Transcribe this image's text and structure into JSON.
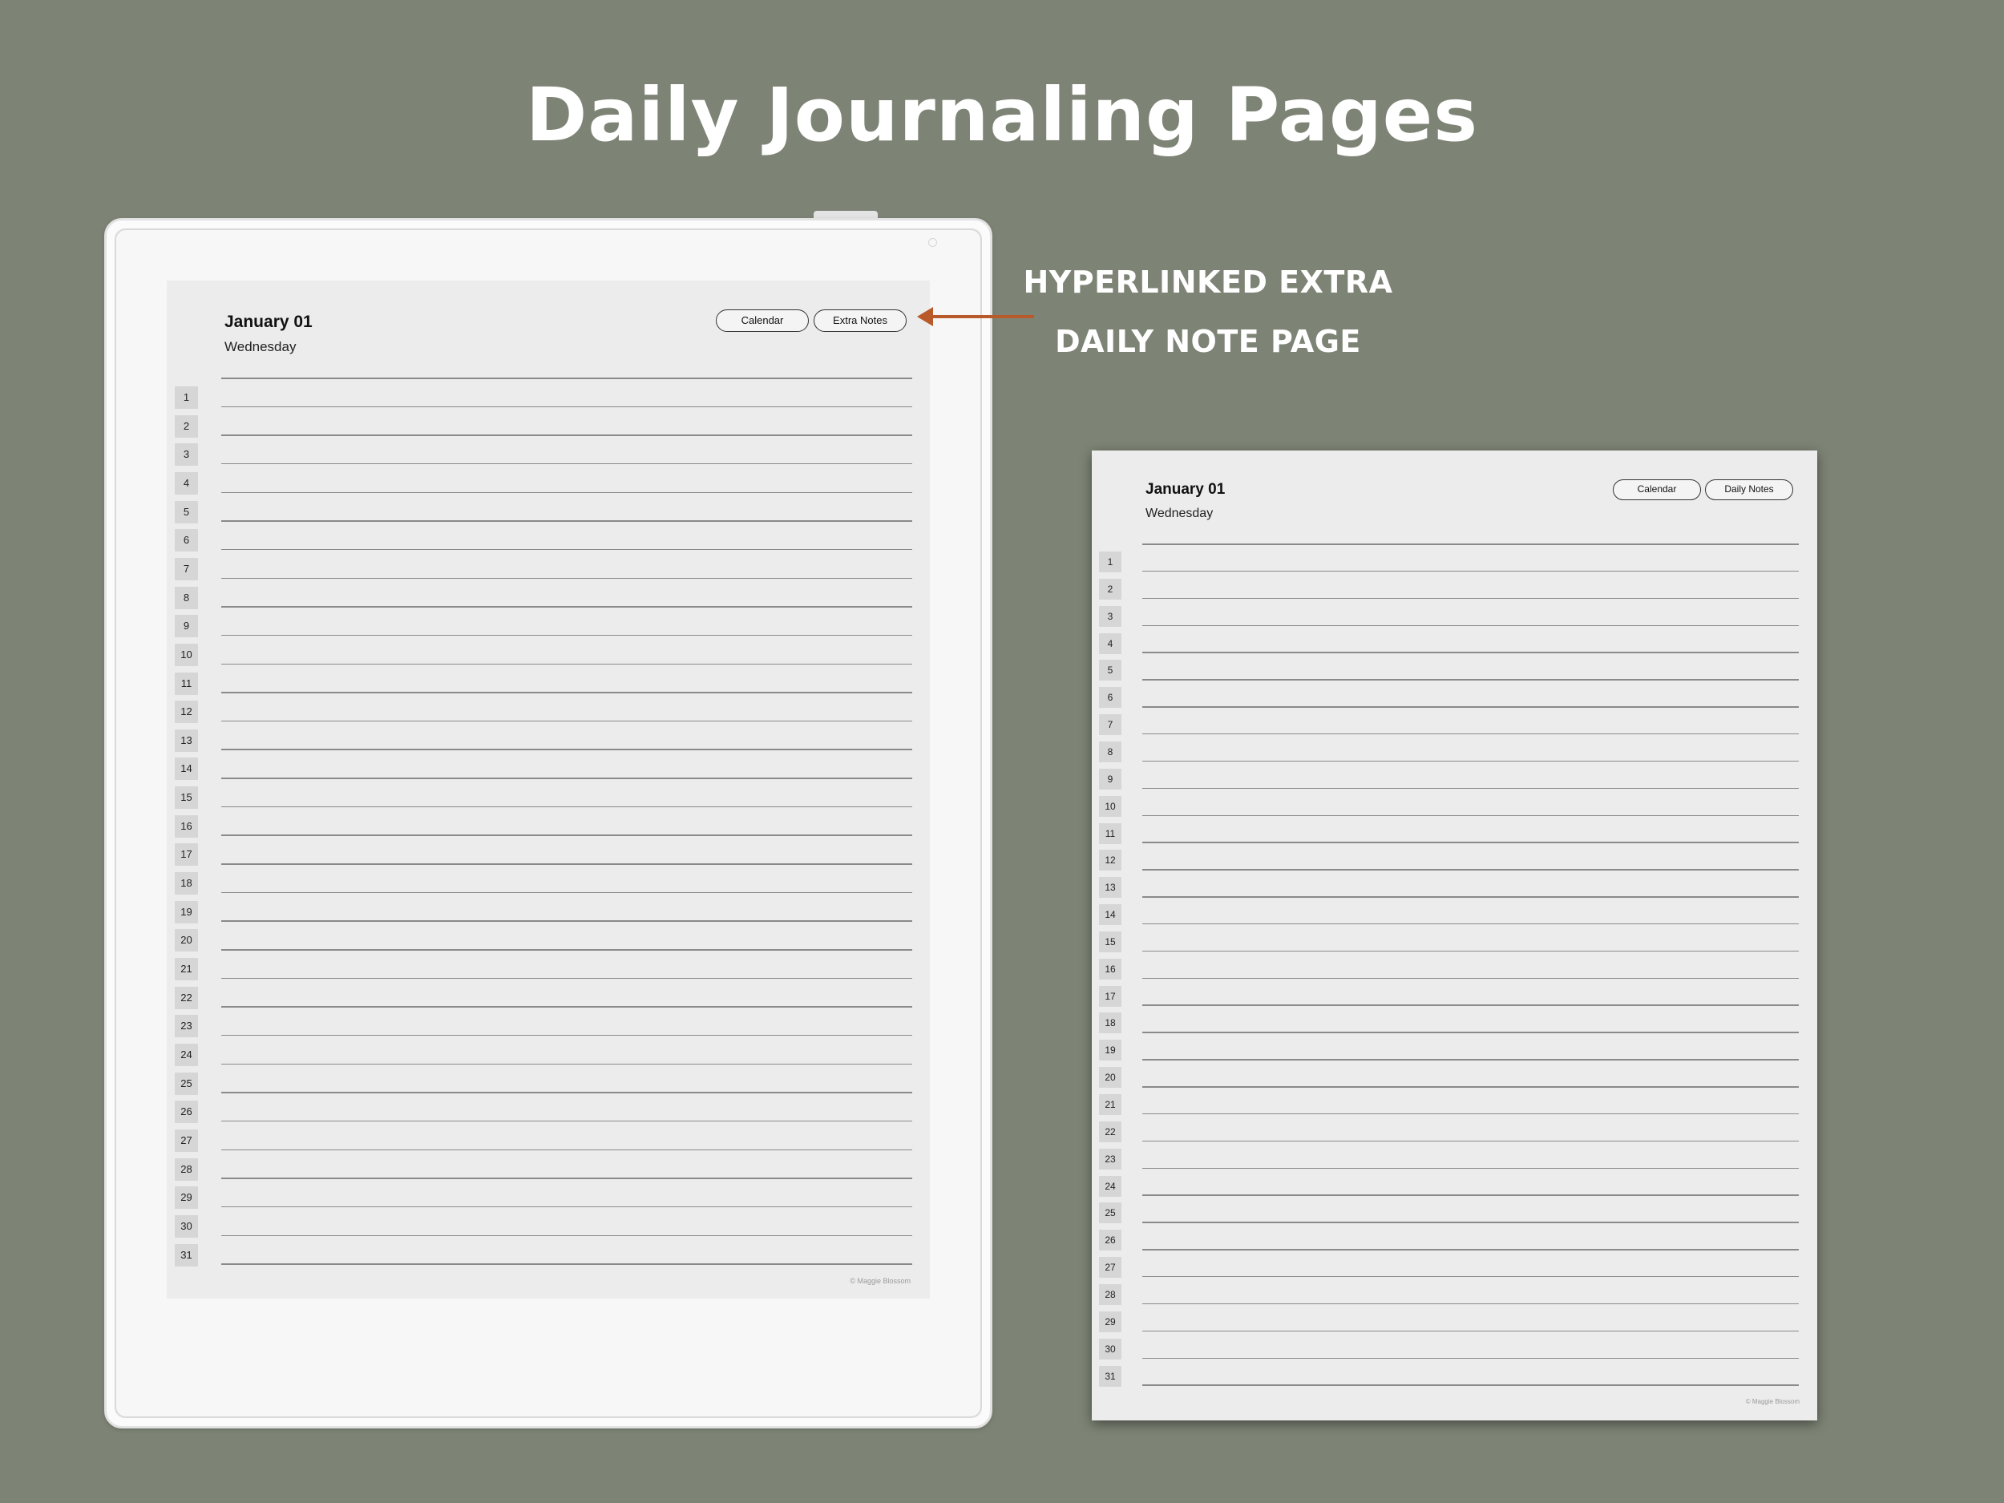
{
  "title": "Daily Journaling Pages",
  "callout": {
    "line1": "HYPERLINKED EXTRA",
    "line2": "DAILY NOTE PAGE",
    "arrow_color": "#b85a2a"
  },
  "colors": {
    "background": "#7d8475",
    "page": "#ececec",
    "number_box": "#d6d6d6"
  },
  "page_primary": {
    "date": "January 01",
    "weekday": "Wednesday",
    "buttons": [
      "Calendar",
      "Extra Notes"
    ],
    "copyright": "© Maggie Blossom"
  },
  "page_secondary": {
    "date": "January 01",
    "weekday": "Wednesday",
    "buttons": [
      "Calendar",
      "Daily Notes"
    ],
    "copyright": "© Maggie Blossom"
  },
  "line_numbers": [
    "1",
    "2",
    "3",
    "4",
    "5",
    "6",
    "7",
    "8",
    "9",
    "10",
    "11",
    "12",
    "13",
    "14",
    "15",
    "16",
    "17",
    "18",
    "19",
    "20",
    "21",
    "22",
    "23",
    "24",
    "25",
    "26",
    "27",
    "28",
    "29",
    "30",
    "31"
  ]
}
